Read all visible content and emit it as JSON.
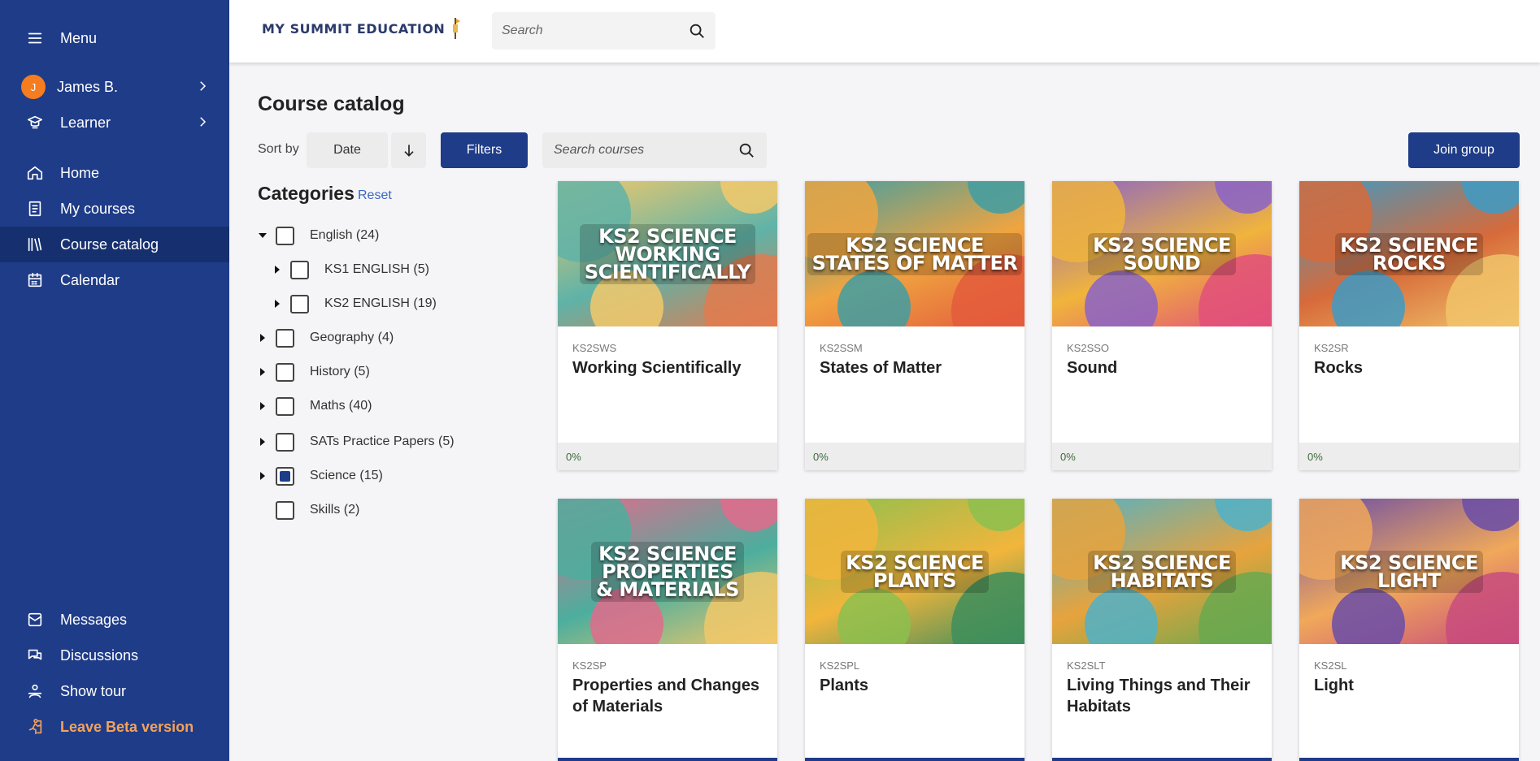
{
  "sidebar": {
    "menu_label": "Menu",
    "user": {
      "initial": "J",
      "name": "James B."
    },
    "role_label": "Learner",
    "nav": [
      {
        "label": "Home",
        "icon": "home-icon"
      },
      {
        "label": "My courses",
        "icon": "book-icon"
      },
      {
        "label": "Course catalog",
        "icon": "library-icon",
        "active": true
      },
      {
        "label": "Calendar",
        "icon": "calendar-icon"
      }
    ],
    "bottom": [
      {
        "label": "Messages",
        "icon": "mail-icon"
      },
      {
        "label": "Discussions",
        "icon": "chat-icon"
      },
      {
        "label": "Show tour",
        "icon": "tour-icon"
      },
      {
        "label": "Leave Beta version",
        "icon": "exit-icon"
      }
    ]
  },
  "header": {
    "logo_text": "MY SUMMIT EDUCATION",
    "search_placeholder": "Search"
  },
  "main": {
    "title": "Course catalog",
    "sort_label": "Sort by",
    "sort_value": "Date",
    "filters_label": "Filters",
    "course_search_placeholder": "Search courses",
    "join_label": "Join group"
  },
  "categories": {
    "title": "Categories",
    "reset_label": "Reset",
    "items": [
      {
        "label": "English (24)",
        "expanded": true,
        "checked": false
      },
      {
        "label": "KS1 ENGLISH (5)",
        "child": true,
        "checked": false
      },
      {
        "label": "KS2 ENGLISH (19)",
        "child": true,
        "checked": false
      },
      {
        "label": "Geography (4)",
        "checked": false
      },
      {
        "label": "History (5)",
        "checked": false
      },
      {
        "label": "Maths (40)",
        "checked": false
      },
      {
        "label": "SATs Practice Papers (5)",
        "checked": false
      },
      {
        "label": "Science (15)",
        "checked": true
      },
      {
        "label": "Skills (2)",
        "checked": false,
        "no_toggle": true
      }
    ]
  },
  "courses": [
    {
      "thumb_title": "KS2 SCIENCE\nWORKING\nSCIENTIFICALLY",
      "code": "KS2SWS",
      "name": "Working Scientifically",
      "progress": "0%",
      "colors": [
        "#f3c96b",
        "#5fb3a8",
        "#e07b4f"
      ]
    },
    {
      "thumb_title": "KS2 SCIENCE\nSTATES OF MATTER",
      "code": "KS2SSM",
      "name": "States of Matter",
      "progress": "0%",
      "colors": [
        "#3f9ea3",
        "#f0a440",
        "#e35c3c"
      ]
    },
    {
      "thumb_title": "KS2 SCIENCE\nSOUND",
      "code": "KS2SSO",
      "name": "Sound",
      "progress": "0%",
      "colors": [
        "#8a63c8",
        "#f0b43c",
        "#e2507a"
      ]
    },
    {
      "thumb_title": "KS2 SCIENCE\nROCKS",
      "code": "KS2SR",
      "name": "Rocks",
      "progress": "0%",
      "colors": [
        "#3d9bc5",
        "#d76a3a",
        "#f1c36a"
      ]
    },
    {
      "thumb_title": "KS2 SCIENCE\nPROPERTIES\n& MATERIALS",
      "code": "KS2SP",
      "name": "Properties and Changes of Materials",
      "progress": "",
      "colors": [
        "#e26b8c",
        "#4cae9e",
        "#f0c86a"
      ]
    },
    {
      "thumb_title": "KS2 SCIENCE\nPLANTS",
      "code": "KS2SPL",
      "name": "Plants",
      "progress": "",
      "colors": [
        "#8cc04f",
        "#f2b53c",
        "#3e8e5c"
      ]
    },
    {
      "thumb_title": "KS2 SCIENCE\nHABITATS",
      "code": "KS2SLT",
      "name": "Living Things and Their Habitats",
      "progress": "",
      "colors": [
        "#4fb2c9",
        "#e7a33d",
        "#6aa84f"
      ]
    },
    {
      "thumb_title": "KS2 SCIENCE\nLIGHT",
      "code": "KS2SL",
      "name": "Light",
      "progress": "",
      "colors": [
        "#6a4ca8",
        "#f0a85a",
        "#c84c7c"
      ]
    }
  ],
  "colors": {
    "sidebar": "#1f3c88",
    "accent": "#1f3c88",
    "beta": "#f5a25a"
  }
}
